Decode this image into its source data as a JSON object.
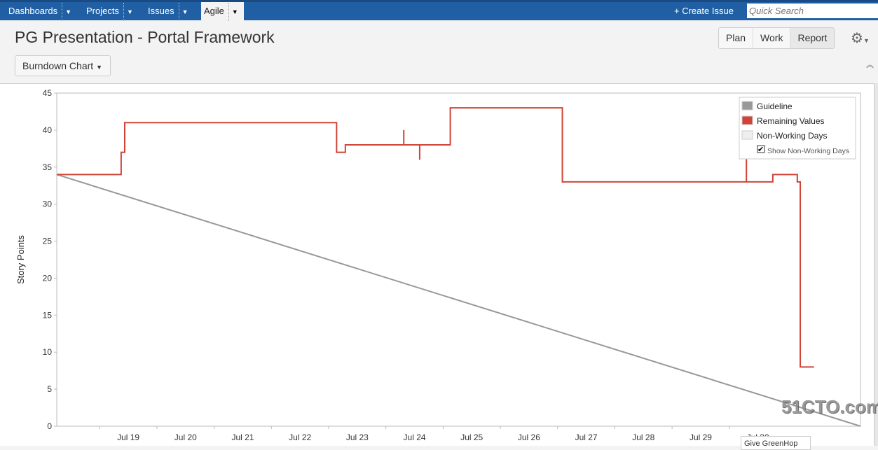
{
  "nav": {
    "items": [
      {
        "label": "Dashboards"
      },
      {
        "label": "Projects"
      },
      {
        "label": "Issues"
      },
      {
        "label": "Agile"
      }
    ],
    "create_issue": "Create Issue",
    "search_placeholder": "Quick Search"
  },
  "header": {
    "title": "PG Presentation - Portal Framework",
    "report_select": "Burndown Chart",
    "modes": [
      "Plan",
      "Work",
      "Report"
    ],
    "active_mode": "Report"
  },
  "tooltip": "Give GreenHop",
  "watermark": "51CTO.com",
  "colors": {
    "nav": "#205fa3",
    "guideline": "#999999",
    "remaining": "#d04437",
    "non_working": "#eeeeee"
  },
  "chart_data": {
    "type": "line",
    "ylabel": "Story Points",
    "ylim": [
      0,
      45
    ],
    "yticks": [
      0,
      5,
      10,
      15,
      20,
      25,
      30,
      35,
      40,
      45
    ],
    "xlim": [
      "Jul 18 06:00",
      "Aug 1 07:00"
    ],
    "xticks": [
      "Jul 19",
      "Jul 20",
      "Jul 21",
      "Jul 22",
      "Jul 23",
      "Jul 24",
      "Jul 25",
      "Jul 26",
      "Jul 27",
      "Jul 28",
      "Jul 29",
      "Jul 30"
    ],
    "grid": false,
    "legend": {
      "placement": "top-right",
      "entries": [
        "Guideline",
        "Remaining Values",
        "Non-Working Days"
      ],
      "checkbox_label": "Show Non-Working Days",
      "checkbox_checked": true
    },
    "series": [
      {
        "name": "Guideline",
        "style": "line",
        "points": [
          [
            "Jul 18 06:00",
            34
          ],
          [
            "Aug 1 07:00",
            0
          ]
        ]
      },
      {
        "name": "Remaining Values",
        "style": "step",
        "points": [
          [
            "Jul 18 06:00",
            34
          ],
          [
            "Jul 19 09:00",
            37
          ],
          [
            "Jul 19 10:30",
            41
          ],
          [
            "Jul 23 03:20",
            37
          ],
          [
            "Jul 23 07:00",
            38
          ],
          [
            "Jul 24 07:30",
            40
          ],
          [
            "Jul 24 07:30",
            38
          ],
          [
            "Jul 24 14:10",
            36
          ],
          [
            "Jul 24 14:10",
            38
          ],
          [
            "Jul 25 03:00",
            43
          ],
          [
            "Jul 27 02:00",
            33
          ],
          [
            "Jul 30 07:10",
            37
          ],
          [
            "Jul 30 07:10",
            33
          ],
          [
            "Jul 30 18:15",
            34
          ],
          [
            "Jul 31 04:30",
            33
          ],
          [
            "Jul 31 05:45",
            8
          ],
          [
            "Jul 31 11:30",
            8
          ]
        ]
      }
    ]
  }
}
